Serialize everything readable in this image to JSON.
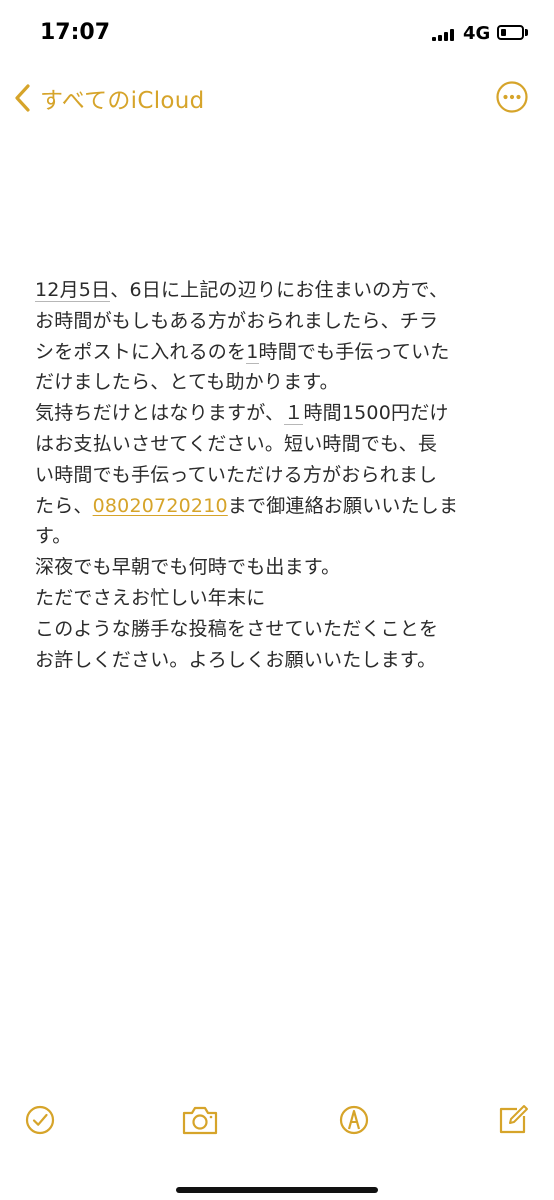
{
  "status": {
    "time": "17:07",
    "network": "4G"
  },
  "nav": {
    "back_label": "すべてのiCloud"
  },
  "note": {
    "lines": [
      {
        "pre": "",
        "underlined": "12月5日",
        "post": "、6日に上記の辺りにお住まいの方で、"
      },
      {
        "text": "お時間がもしもある方がおられましたら、チラ"
      },
      {
        "pre": "シをポストに入れるのを",
        "underlined": "1",
        "post": "時間でも手伝っていた"
      },
      {
        "text": "だけましたら、とても助かります。"
      },
      {
        "pre": "気持ちだけとはなりますが、",
        "underlined": "１",
        "post": "時間1500円だけ"
      },
      {
        "text": "はお支払いさせてください。短い時間でも、長"
      },
      {
        "text": "い時間でも手伝っていただける方がおられまし"
      },
      {
        "pre": "たら、",
        "phone": "08020720210",
        "post": "まで御連絡お願いいたしま"
      },
      {
        "text": "す。"
      },
      {
        "text": "深夜でも早朝でも何時でも出ます。"
      },
      {
        "text": "ただでさえお忙しい年末に"
      },
      {
        "text": "このような勝手な投稿をさせていただくことを"
      },
      {
        "text": "お許しください。よろしくお願いいたします。"
      }
    ]
  },
  "toolbar": {
    "items": [
      "checklist-icon",
      "camera-icon",
      "markup-icon",
      "compose-icon"
    ]
  },
  "colors": {
    "accent": "#d6a42a",
    "text": "#2b2b2b",
    "background": "#ffffff"
  }
}
